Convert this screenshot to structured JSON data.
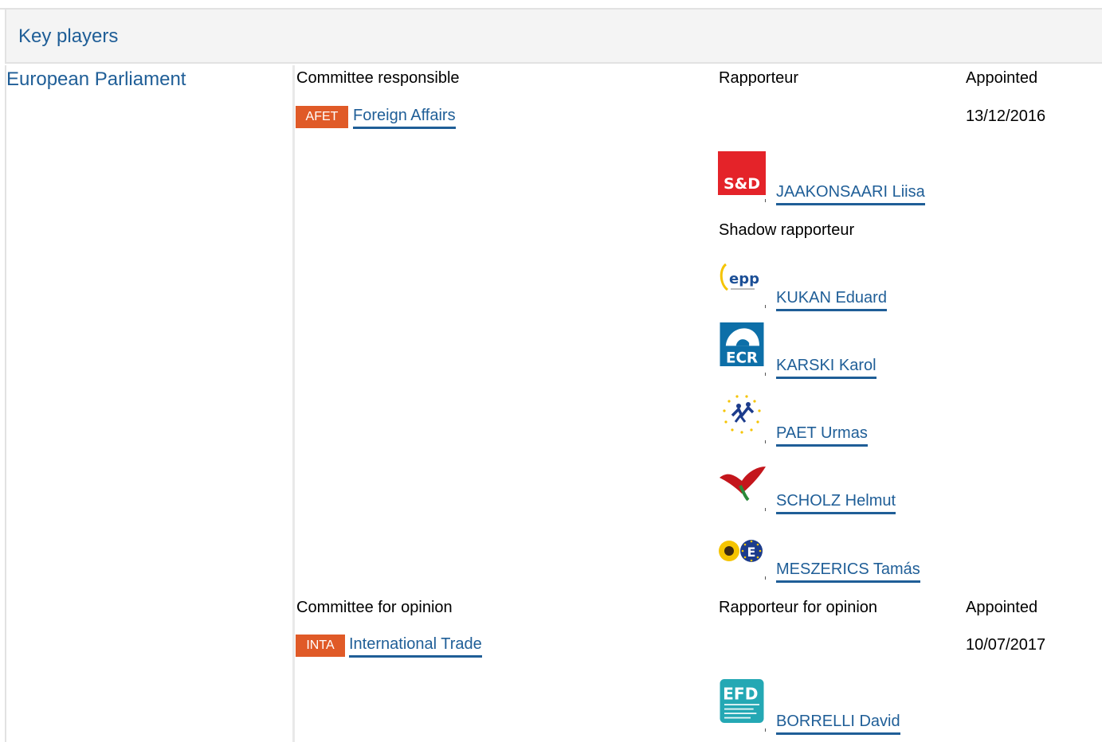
{
  "section": {
    "title": "Key players"
  },
  "institution": "European Parliament",
  "committee_responsible": {
    "heading": "Committee responsible",
    "rapporteur_heading": "Rapporteur",
    "appointed_heading": "Appointed",
    "abbr": "AFET",
    "name": "Foreign Affairs",
    "appointed": "13/12/2016",
    "rapporteur": {
      "name": "JAAKONSAARI Liisa",
      "group_logo": "S&D"
    },
    "shadow_heading": "Shadow rapporteur",
    "shadows": [
      {
        "name": "KUKAN Eduard",
        "group_logo": "epp"
      },
      {
        "name": "KARSKI Karol",
        "group_logo": "ECR"
      },
      {
        "name": "PAET Urmas",
        "group_logo": "alde-logo"
      },
      {
        "name": "SCHOLZ Helmut",
        "group_logo": "gue-ngl-logo"
      },
      {
        "name": "MESZERICS Tamás",
        "group_logo": "greens-efa-logo"
      }
    ]
  },
  "committee_opinion": {
    "heading": "Committee for opinion",
    "rapporteur_heading": "Rapporteur for opinion",
    "appointed_heading": "Appointed",
    "abbr": "INTA",
    "name": "International Trade",
    "appointed": "10/07/2017",
    "rapporteur": {
      "name": "BORRELLI David",
      "group_logo": "EFD"
    }
  },
  "colors": {
    "link": "#1f5e97",
    "badge": "#e05a27",
    "header_bg": "#f4f4f4",
    "border": "#e2e2e2"
  }
}
